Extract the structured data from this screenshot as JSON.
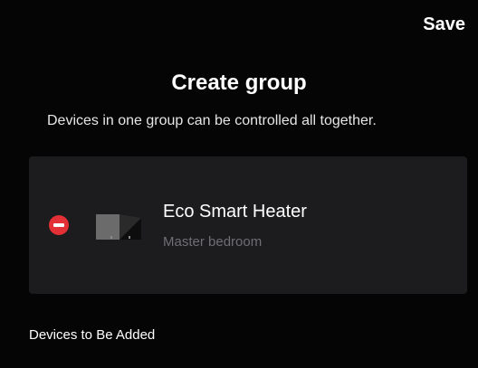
{
  "header": {
    "save_label": "Save"
  },
  "page": {
    "title": "Create group",
    "subtitle": "Devices in one group can be controlled all together."
  },
  "devices": [
    {
      "name": "Eco Smart Heater",
      "room": "Master bedroom"
    }
  ],
  "sections": {
    "to_be_added_label": "Devices to Be Added"
  },
  "icons": {
    "remove": "remove-circle-icon",
    "device": "heater-device-icon"
  },
  "colors": {
    "background": "#000000",
    "card": "#1c1c1e",
    "remove_red": "#e33036",
    "secondary_text": "#6f6f73"
  }
}
